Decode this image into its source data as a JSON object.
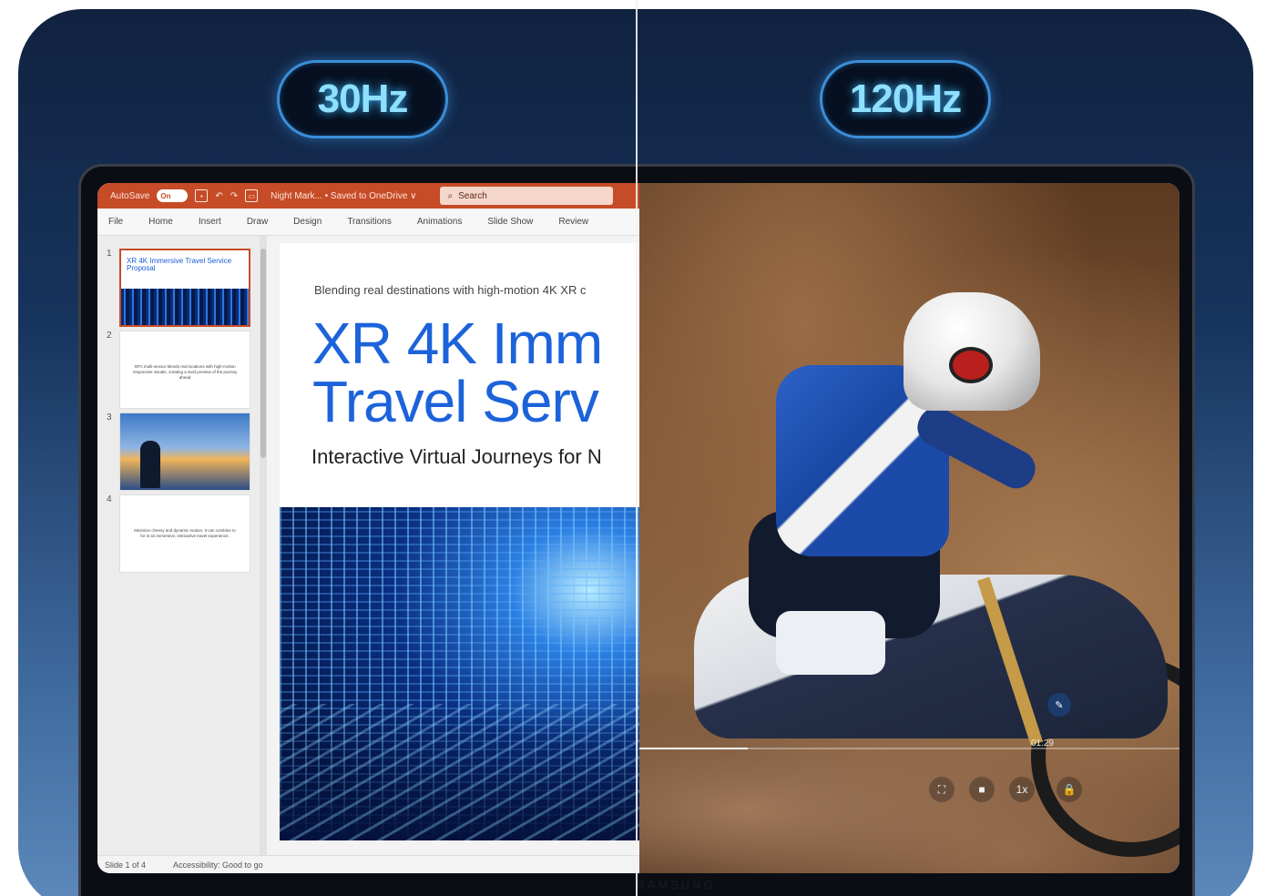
{
  "labels": {
    "left_rate": "30Hz",
    "right_rate": "120Hz"
  },
  "laptop": {
    "brand": "SAMSUNG"
  },
  "powerpoint": {
    "autosave_label": "AutoSave",
    "autosave_state": "On",
    "doc_title": "Night Mark... • Saved to OneDrive ∨",
    "search_placeholder": "Search",
    "ribbon_tabs": [
      "File",
      "Home",
      "Insert",
      "Draw",
      "Design",
      "Transitions",
      "Animations",
      "Slide Show",
      "Review"
    ],
    "thumbnails": [
      {
        "num": "1",
        "title": "XR 4K Immersive Travel Service Proposal"
      },
      {
        "num": "2",
        "text": "XR's multi-sensor blends real locations with high-motion responsive visuals, creating a vivid preview of the journey ahead"
      },
      {
        "num": "3"
      },
      {
        "num": "4",
        "text": "Minimize cheesy and dynamic motion. It can combine to for is an immersive, interactive travel experience."
      }
    ],
    "slide": {
      "eyebrow": "Blending real destinations with high-motion 4K XR c",
      "title_line1": "XR 4K Imm",
      "title_line2": "Travel Serv",
      "subtitle": "Interactive Virtual Journeys for N"
    },
    "status": {
      "slide_of": "Slide 1 of 4",
      "accessibility": "Accessibility: Good to go"
    },
    "accent_color": "#c64b27"
  },
  "video": {
    "time": "01:29",
    "progress": 0.2,
    "controls": [
      "fit-icon",
      "stop-icon",
      "speed-label",
      "lock-icon"
    ],
    "speed": "1x"
  }
}
